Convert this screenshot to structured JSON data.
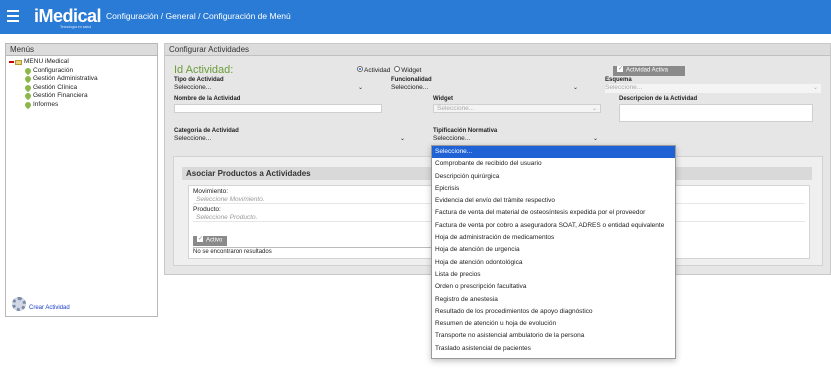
{
  "header": {
    "logo_text": "iMedical",
    "logo_tagline": "Tecnología en salud",
    "breadcrumb": "Configuración / General / Configuración de Menú"
  },
  "sidebar": {
    "title": "Menús",
    "root": "MENU iMedical",
    "items": [
      "Configuración",
      "Gestión Administrativa",
      "Gestión Clínica",
      "Gestión Financiera",
      "Informes"
    ],
    "footer_link": "Crear Actividad"
  },
  "form": {
    "panel_title": "Configurar Actividades",
    "id_label": "Id Actividad:",
    "radio_actividad": "Actividad",
    "radio_widget": "Widget",
    "active_button": "Actividad Activa",
    "tipo_label": "Tipo de Actividad",
    "tipo_value": "Seleccione...",
    "funcionalidad_label": "Funcionalidad",
    "funcionalidad_value": "Seleccione...",
    "esquema_label": "Esquema",
    "esquema_value": "Seleccione...",
    "nombre_label": "Nombre de la Actividad",
    "widget_label": "Widget",
    "widget_value": "Seleccione...",
    "descripcion_label": "Descripcion de la Actividad",
    "categoria_label": "Categoria de Actividad",
    "categoria_value": "Seleccione...",
    "tipificacion_label": "Tipificación Normativa",
    "tipificacion_value": "Seleccione..."
  },
  "assoc": {
    "title": "Asociar Productos a Actividades",
    "movimiento_label": "Movimiento:",
    "movimiento_placeholder": "Seleccione Movimiento.",
    "producto_label": "Producto:",
    "producto_placeholder": "Seleccione Producto.",
    "activo_button": "Activo",
    "no_results": "No se encontraron resultados"
  },
  "dropdown": {
    "options": [
      "Seleccione...",
      "Comprobante de recibido del usuario",
      "Descripción quirúrgica",
      "Epicrisis",
      "Evidencia del envío del trámite respectivo",
      "Factura de venta del material de osteosíntesis expedida por el proveedor",
      "Factura de venta por cobro a aseguradora SOAT, ADRES o entidad equivalente",
      "Hoja de administración de medicamentos",
      "Hoja de atención de urgencia",
      "Hoja de atención odontológica",
      "Lista de precios",
      "Orden o prescripción facultativa",
      "Registro de anestesia",
      "Resultado de los procedimientos de apoyo diagnóstico",
      "Resumen de atención u hoja de evolución",
      "Transporte no asistencial ambulatorio de la persona",
      "Traslado asistencial de pacientes"
    ],
    "selected_index": 0
  },
  "colors": {
    "topbar": "#2a7bd5",
    "highlight": "#1e62d6",
    "id_title": "#6a9d3a"
  }
}
